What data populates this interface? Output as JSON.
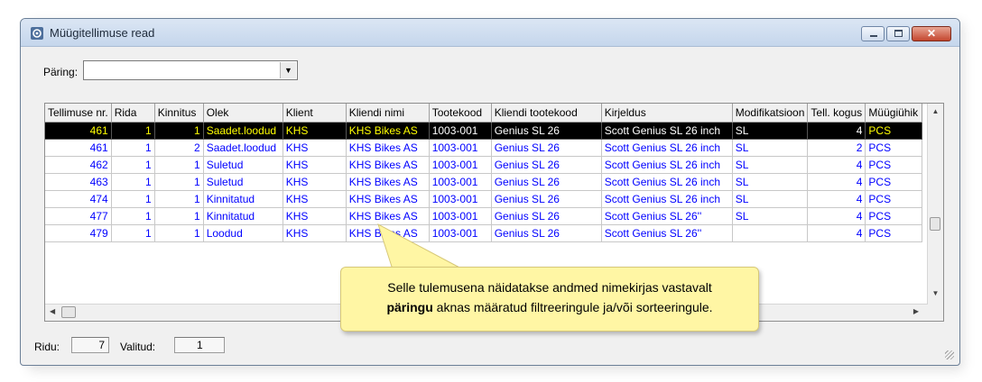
{
  "window": {
    "title": "Müügitellimuse read",
    "icon": "order-lines-icon",
    "controls": {
      "minimize": "minimize-icon",
      "maximize": "maximize-icon",
      "close": "✕"
    }
  },
  "query": {
    "label": "Päring:",
    "value": ""
  },
  "grid": {
    "columns": [
      "Tellimuse nr.",
      "Rida",
      "Kinnitus",
      "Olek",
      "Klient",
      "Kliendi nimi",
      "Tootekood",
      "Kliendi tootekood",
      "Kirjeldus",
      "Modifikatsioon",
      "Tell. kogus",
      "Müügiühik"
    ],
    "rows": [
      {
        "order": "461",
        "line": "1",
        "confirm": "1",
        "status": "Saadet.loodud",
        "client": "KHS",
        "client_name": "KHS Bikes AS",
        "product": "1003-001",
        "client_product": "Genius SL 26",
        "description": "Scott Genius SL 26 inch",
        "modification": "SL",
        "qty": "4",
        "unit": "PCS",
        "selected": true
      },
      {
        "order": "461",
        "line": "1",
        "confirm": "2",
        "status": "Saadet.loodud",
        "client": "KHS",
        "client_name": "KHS Bikes AS",
        "product": "1003-001",
        "client_product": "Genius SL 26",
        "description": "Scott Genius SL 26 inch",
        "modification": "SL",
        "qty": "2",
        "unit": "PCS"
      },
      {
        "order": "462",
        "line": "1",
        "confirm": "1",
        "status": "Suletud",
        "client": "KHS",
        "client_name": "KHS Bikes AS",
        "product": "1003-001",
        "client_product": "Genius SL 26",
        "description": "Scott Genius SL 26 inch",
        "modification": "SL",
        "qty": "4",
        "unit": "PCS"
      },
      {
        "order": "463",
        "line": "1",
        "confirm": "1",
        "status": "Suletud",
        "client": "KHS",
        "client_name": "KHS Bikes AS",
        "product": "1003-001",
        "client_product": "Genius SL 26",
        "description": "Scott Genius SL 26 inch",
        "modification": "SL",
        "qty": "4",
        "unit": "PCS"
      },
      {
        "order": "474",
        "line": "1",
        "confirm": "1",
        "status": "Kinnitatud",
        "client": "KHS",
        "client_name": "KHS Bikes AS",
        "product": "1003-001",
        "client_product": "Genius SL 26",
        "description": "Scott Genius SL 26 inch",
        "modification": "SL",
        "qty": "4",
        "unit": "PCS"
      },
      {
        "order": "477",
        "line": "1",
        "confirm": "1",
        "status": "Kinnitatud",
        "client": "KHS",
        "client_name": "KHS Bikes AS",
        "product": "1003-001",
        "client_product": "Genius SL 26",
        "description": "Scott Genius SL 26''",
        "modification": "SL",
        "qty": "4",
        "unit": "PCS"
      },
      {
        "order": "479",
        "line": "1",
        "confirm": "1",
        "status": "Loodud",
        "client": "KHS",
        "client_name": "KHS Bikes AS",
        "product": "1003-001",
        "client_product": "Genius SL 26",
        "description": "Scott Genius SL 26''",
        "modification": "",
        "qty": "4",
        "unit": "PCS"
      }
    ]
  },
  "callout": {
    "line1": "Selle tulemusena näidatakse andmed nimekirjas vastavalt",
    "line2_bold": "päringu",
    "line2_rest": " aknas määratud filtreeringule ja/või sorteeringule."
  },
  "status": {
    "rows_label": "Ridu:",
    "rows_value": "7",
    "selected_label": "Valitud:",
    "selected_value": "1"
  },
  "colors": {
    "row_text": "#0000ff",
    "selected_bg": "#000000",
    "selected_text": "#ffff00",
    "callout_bg": "#fff6a4"
  }
}
